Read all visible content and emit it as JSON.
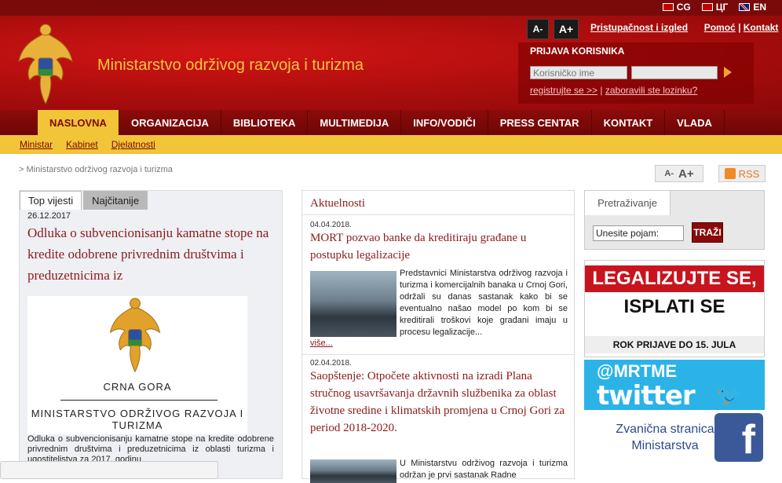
{
  "languages": [
    {
      "code": "CG"
    },
    {
      "code": "ЦГ"
    },
    {
      "code": "EN"
    }
  ],
  "header": {
    "title": "Ministarstvo održivog razvoja i turizma",
    "font_small": "A-",
    "font_large": "A+",
    "accessibility_link": "Pristupačnost i izgled",
    "help_link": "Pomoć",
    "separator": " | ",
    "contact_link": "Kontakt"
  },
  "login": {
    "title": "PRIJAVA KORISNIKA",
    "username_placeholder": "Korisničko ime",
    "register_link": "registrujte se >>",
    "separator": " | ",
    "forgot_link": "zaboravili ste lozinku?"
  },
  "nav": {
    "items": [
      "NASLOVNA",
      "ORGANIZACIJA",
      "BIBLIOTEKA",
      "MULTIMEDIJA",
      "INFO/VODIČI",
      "PRESS CENTAR",
      "KONTAKT",
      "VLADA"
    ],
    "active": 0
  },
  "subnav": {
    "items": [
      "Ministar",
      "Kabinet",
      "Djelatnosti"
    ]
  },
  "breadcrumb": "> Ministarstvo održivog razvoja i turizma",
  "fontsize": {
    "small": "A-",
    "large": "A+"
  },
  "rss_label": "RSS",
  "left": {
    "tab_top": "Top vijesti",
    "tab_read": "Najčitanije",
    "date": "26.12.2017",
    "title": "Odluka o subvencionisanju kamatne stope na kredite odobrene privrednim društvima i preduzetnicima iz",
    "img_caption_country": "CRNA GORA",
    "img_caption_ministry": "MINISTARSTVO ODRŽIVOG RAZVOJA I TURIZMA",
    "description": "Odluka o subvencionisanju kamatne stope na kredite odobrene privrednim društvima i preduzetnicima iz oblasti turizma i ugostiteljstva za 2017. godinu"
  },
  "news": {
    "heading": "Aktuelnosti",
    "items": [
      {
        "date": "04.04.2018.",
        "title": "MORT pozvao banke da kreditiraju građane u postupku legalizacije",
        "text": "Predstavnici Ministarstva održivog razvoja i turizma i komercijalnih banaka u Crnoj Gori, održali su danas sastanak kako bi se eventualno našao model po kom bi se kreditirali troškovi koje građani imaju u procesu legalizacije...",
        "more": "više..."
      },
      {
        "date": "02.04.2018.",
        "title": "Saopštenje: Otpočete aktivnosti na izradi Plana stručnog usavršavanja državnih službenika za oblast životne sredine i klimatskih promjena u Crnoj Gori za period 2018-2020.",
        "text": "U Ministarstvu održivog razvoja i turizma održan je prvi sastanak Radne"
      }
    ]
  },
  "search": {
    "tab": "Pretraživanje",
    "placeholder": "Unesite pojam:",
    "button": "TRAŽI"
  },
  "banners": {
    "legal_line1": "LEGALIZUJTE SE,",
    "legal_line2": "ISPLATI SE",
    "legal_line3": "ROK PRIJAVE DO 15. JULA",
    "twitter_handle": "@MRTME",
    "twitter_word": "twitter",
    "facebook_text": "Zvanična stranica Ministarstva",
    "facebook_letter": "f"
  },
  "colors": {
    "header_red": "#b20e0e",
    "nav_dark": "#7a0a0a",
    "gold": "#f2c437",
    "title_gold": "#f5c542",
    "link_red": "#8b1a1a",
    "twitter_blue": "#2bb3e8",
    "facebook_blue": "#3b5998"
  }
}
